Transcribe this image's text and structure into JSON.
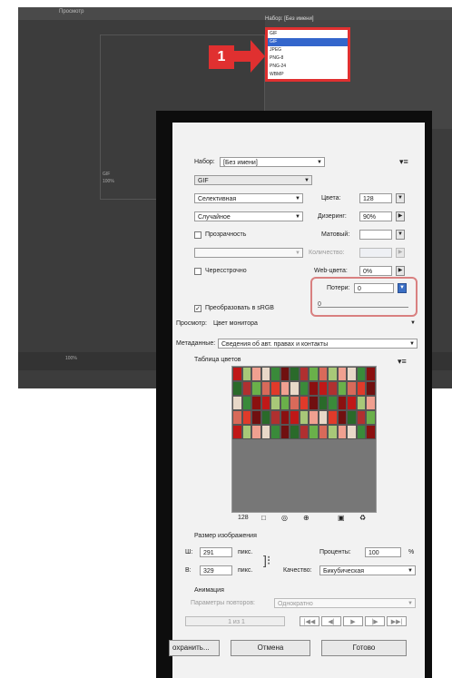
{
  "workspace": {
    "tab_label": "Просмотр",
    "preset_header": "Набор: [Без имени]",
    "format_options": [
      "GIF",
      "GIF",
      "JPEG",
      "PNG-8",
      "PNG-24",
      "WBMP"
    ],
    "selected_index": 1,
    "badge": "1",
    "canvas_info_1": "GIF",
    "canvas_info_2": "100%",
    "bottom_info": "100%"
  },
  "dialog": {
    "preset_label": "Набор:",
    "preset_value": "[Без имени]",
    "format_value": "GIF",
    "reduction_value": "Селективная",
    "dither_value": "Случайное",
    "transparency_label": "Прозрачность",
    "interlaced_label": "Чересстрочно",
    "colors_label": "Цвета:",
    "colors_value": "128",
    "dither_pct_label": "Дизеринг:",
    "dither_pct_value": "90%",
    "matte_label": "Матовый:",
    "amount_label": "Количество:",
    "websnap_label": "Web-цвета:",
    "websnap_value": "0%",
    "lossy_label": "Потери:",
    "lossy_value": "0",
    "lossy_slider_value": "0",
    "convert_srgb_label": "Преобразовать в sRGB",
    "preview_label": "Просмотр:",
    "preview_value": "Цвет монитора",
    "metadata_label": "Метаданные:",
    "metadata_value": "Сведения об авт. правах и контакты",
    "color_table_label": "Таблица цветов",
    "color_count": "128",
    "image_size_label": "Размер изображения",
    "width_label": "Ш:",
    "width_value": "291",
    "height_label": "В:",
    "height_value": "329",
    "unit": "пикс.",
    "percent_label": "Проценты:",
    "percent_value": "100",
    "percent_sign": "%",
    "quality_label": "Качество:",
    "quality_value": "Бикубическая",
    "animation_label": "Анимация",
    "loop_label": "Параметры повторов:",
    "loop_value": "Однократно",
    "frame_counter": "1 из 1",
    "save_button": "охранить...",
    "cancel_button": "Отмена",
    "done_button": "Готово"
  },
  "colors": {
    "palette": [
      "#c01818",
      "#e03a2a",
      "#8b1010",
      "#d86a5a",
      "#3a8a3a",
      "#6ab04a",
      "#e8d8c8",
      "#b03030",
      "#f0a090",
      "#2a6a2a",
      "#a8c878",
      "#701010"
    ]
  }
}
